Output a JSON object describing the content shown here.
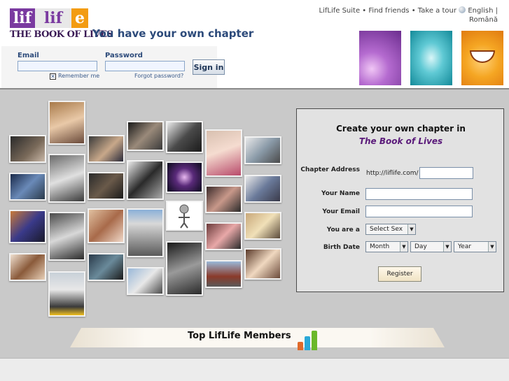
{
  "header": {
    "logo_text": "lif life",
    "logo_subtitle": "THE BOOK OF LIVES",
    "tagline": "You have your own chapter"
  },
  "topnav": {
    "links": [
      "LifLife Suite",
      "Find friends",
      "Take a tour"
    ],
    "separator": "•",
    "languages": [
      "English",
      "Română"
    ],
    "language_separator": "|"
  },
  "login": {
    "email_label": "Email",
    "email_value": "",
    "password_label": "Password",
    "password_value": "",
    "sign_in_label": "Sign in",
    "remember_label": "Remember me",
    "remember_checked": true,
    "forgot_label": "Forgot password?"
  },
  "signup": {
    "title_line1": "Create your own chapter in",
    "title_line2": "The Book of Lives",
    "chapter_label": "Chapter Address",
    "chapter_prefix": "http://liflife.com/",
    "chapter_value": "",
    "name_label": "Your Name",
    "name_value": "",
    "email_label": "Your Email",
    "email_value": "",
    "gender_label": "You are a",
    "gender_select": "Select Sex",
    "birth_label": "Birth Date",
    "month_select": "Month",
    "day_select": "Day",
    "year_select": "Year",
    "register_label": "Register"
  },
  "members": {
    "title": "Top LifLife Members"
  },
  "colors": {
    "brand_purple": "#7a3aa0",
    "brand_orange": "#f39c12",
    "link_blue": "#2c4a7a",
    "title_purple": "#5a1a7a"
  },
  "icons": {
    "globe": "globe-icon",
    "checkbox": "checkbox-icon",
    "select_arrow": "chevron-down-icon",
    "members_chart": "bar-chart-icon"
  }
}
